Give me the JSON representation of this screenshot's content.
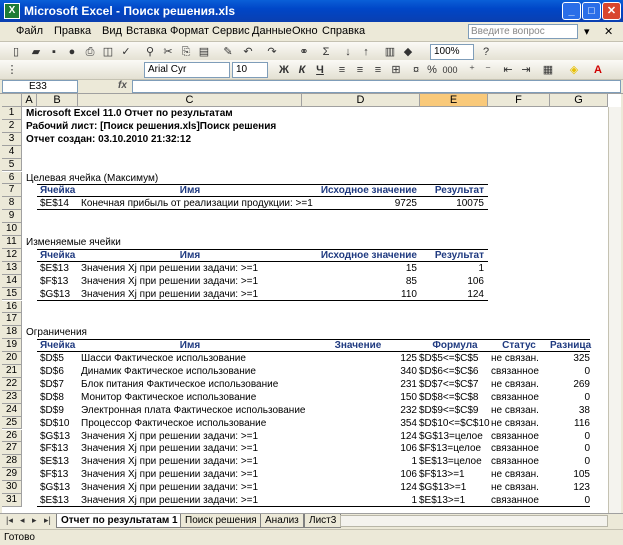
{
  "window": {
    "title": "Microsoft Excel - Поиск решения.xls"
  },
  "menu": [
    "Файл",
    "Правка",
    "Вид",
    "Вставка",
    "Формат",
    "Сервис",
    "Данные",
    "Окно",
    "Справка"
  ],
  "help_placeholder": "Введите вопрос",
  "toolbar": {
    "zoom": "100%",
    "font": "Arial Cyr",
    "size": "10"
  },
  "formula_bar": {
    "name_box": "E33",
    "fx": "fx",
    "value": ""
  },
  "columns": [
    "A",
    "B",
    "C",
    "D",
    "E",
    "F",
    "G"
  ],
  "rows": [
    "1",
    "2",
    "3",
    "4",
    "5",
    "6",
    "7",
    "8",
    "9",
    "10",
    "11",
    "12",
    "13",
    "14",
    "15",
    "16",
    "17",
    "18",
    "19",
    "20",
    "21",
    "22",
    "23",
    "24",
    "25",
    "26",
    "27",
    "28",
    "29",
    "30",
    "31"
  ],
  "report": {
    "line1": "Microsoft Excel 11.0 Отчет по результатам",
    "line2": "Рабочий лист: [Поиск решения.xls]Поиск решения",
    "line3": "Отчет создан: 03.10.2010 21:32:12"
  },
  "target": {
    "title": "Целевая ячейка (Максимум)",
    "headers": [
      "Ячейка",
      "Имя",
      "Исходное значение",
      "Результат"
    ],
    "rows": [
      [
        "$E$14",
        "Конечная прибыль от реализации продукции: >=1",
        "9725",
        "10075"
      ]
    ]
  },
  "changing": {
    "title": "Изменяемые ячейки",
    "headers": [
      "Ячейка",
      "Имя",
      "Исходное значение",
      "Результат"
    ],
    "rows": [
      [
        "$E$13",
        "Значения Xj при решении задачи: >=1",
        "15",
        "1"
      ],
      [
        "$F$13",
        "Значения Xj при решении задачи: >=1",
        "85",
        "106"
      ],
      [
        "$G$13",
        "Значения Xj при решении задачи: >=1",
        "110",
        "124"
      ]
    ]
  },
  "constraints": {
    "title": "Ограничения",
    "headers": [
      "Ячейка",
      "Имя",
      "Значение",
      "Формула",
      "Статус",
      "Разница"
    ],
    "rows": [
      [
        "$D$5",
        "Шасси Фактическое использование",
        "125",
        "$D$5<=$C$5",
        "не связан.",
        "325"
      ],
      [
        "$D$6",
        "Динамик Фактическое использование",
        "340",
        "$D$6<=$C$6",
        "связанное",
        "0"
      ],
      [
        "$D$7",
        "Блок питания Фактическое использование",
        "231",
        "$D$7<=$C$7",
        "не связан.",
        "269"
      ],
      [
        "$D$8",
        "Монитор Фактическое использование",
        "150",
        "$D$8<=$C$8",
        "связанное",
        "0"
      ],
      [
        "$D$9",
        "Электронная плата Фактическое использование",
        "232",
        "$D$9<=$C$9",
        "не связан.",
        "38"
      ],
      [
        "$D$10",
        "Процессор Фактическое использование",
        "354",
        "$D$10<=$C$10",
        "не связан.",
        "116"
      ],
      [
        "$G$13",
        "Значения Xj при решении задачи: >=1",
        "124",
        "$G$13=целое",
        "связанное",
        "0"
      ],
      [
        "$F$13",
        "Значения Xj при решении задачи: >=1",
        "106",
        "$F$13=целое",
        "связанное",
        "0"
      ],
      [
        "$E$13",
        "Значения Xj при решении задачи: >=1",
        "1",
        "$E$13=целое",
        "связанное",
        "0"
      ],
      [
        "$F$13",
        "Значения Xj при решении задачи: >=1",
        "106",
        "$F$13>=1",
        "не связан.",
        "105"
      ],
      [
        "$G$13",
        "Значения Xj при решении задачи: >=1",
        "124",
        "$G$13>=1",
        "не связан.",
        "123"
      ],
      [
        "$E$13",
        "Значения Xj при решении задачи: >=1",
        "1",
        "$E$13>=1",
        "связанное",
        "0"
      ]
    ]
  },
  "tabs": [
    "Отчет по результатам 1",
    "Поиск решения",
    "Анализ",
    "Лист3"
  ],
  "status": "Готово"
}
